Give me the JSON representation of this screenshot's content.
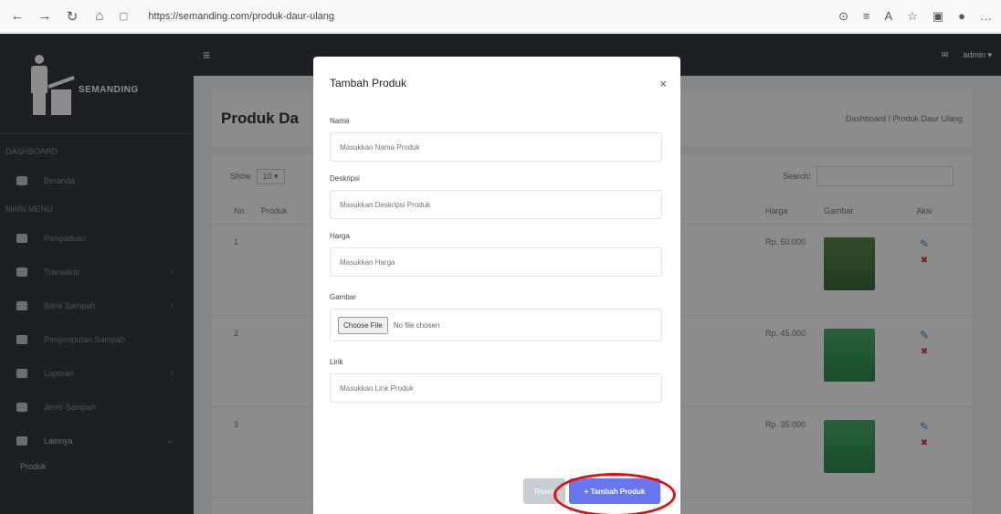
{
  "browser": {
    "url": "https://semanding.com/produk-daur-ulang"
  },
  "sidebar": {
    "brand": "SEMANDING",
    "header1": "DASHBOARD",
    "header2": "MAIN MENU",
    "items": [
      {
        "label": "Beranda",
        "has_chevron": false
      },
      {
        "label": "Pengaduan",
        "has_chevron": false
      },
      {
        "label": "Transaksi",
        "has_chevron": true
      },
      {
        "label": "Bank Sampah",
        "has_chevron": true
      },
      {
        "label": "Penjemputan Sampah",
        "has_chevron": false
      },
      {
        "label": "Laporan",
        "has_chevron": true
      },
      {
        "label": "Jenis Sampah",
        "has_chevron": false
      },
      {
        "label": "Lainnya",
        "has_chevron": true
      }
    ],
    "sub_item": "Produk"
  },
  "topbar": {
    "user": "admin"
  },
  "content": {
    "title": "Produk Da",
    "breadcrumb": "Dashboard / Produk Daur Ulang"
  },
  "table": {
    "show_label": "Show",
    "show_value": "10",
    "search_label": "Search:",
    "headers": {
      "no": "No.",
      "produk": "Produk",
      "harga": "Harga",
      "gambar": "Gambar",
      "aksi": "Aksi"
    },
    "rows": [
      {
        "no": "1",
        "harga": "Rp. 50.000"
      },
      {
        "no": "2",
        "harga": "Rp. 45.000"
      },
      {
        "no": "3",
        "harga": "Rp. 35.000"
      }
    ]
  },
  "modal": {
    "title": "Tambah Produk",
    "close": "×",
    "fields": {
      "nama_label": "Nama",
      "nama_placeholder": "Masukkan Nama Produk",
      "deskripsi_label": "Deskripsi",
      "deskripsi_placeholder": "Masukkan Deskripsi Produk",
      "harga_label": "Harga",
      "harga_placeholder": "Masukkan Harga",
      "gambar_label": "Gambar",
      "file_button": "Choose File",
      "file_status": "No file chosen",
      "link_label": "Link",
      "link_placeholder": "Masukkan Link Produk"
    },
    "buttons": {
      "reset": "Reset",
      "submit": "+ Tambah Produk"
    }
  },
  "colors": {
    "sidebar": "#343a40",
    "primary_button": "#6777ef",
    "highlight_circle": "#e01010"
  }
}
